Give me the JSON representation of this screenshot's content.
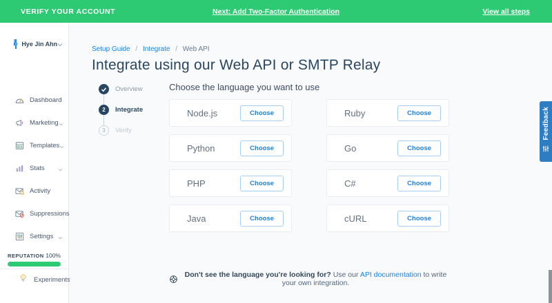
{
  "banner": {
    "title": "VERIFY YOUR ACCOUNT",
    "next_link": "Next: Add Two-Factor Authentication",
    "view_all_link": "View all steps",
    "bg_color": "#2eca73"
  },
  "sidebar": {
    "user": {
      "name": "Hye Jin Ahn"
    },
    "items": [
      {
        "label": "Dashboard"
      },
      {
        "label": "Marketing"
      },
      {
        "label": "Templates"
      },
      {
        "label": "Stats"
      },
      {
        "label": "Activity"
      },
      {
        "label": "Suppressions"
      },
      {
        "label": "Settings"
      }
    ],
    "reputation": {
      "label": "REPUTATION",
      "value": "100%",
      "progress_pct": 100,
      "bar_color": "#2eca73"
    },
    "experiments": {
      "label": "Experiments"
    }
  },
  "main": {
    "breadcrumb": {
      "items": [
        {
          "label": "Setup Guide"
        },
        {
          "label": "Integrate"
        },
        {
          "label": "Web API"
        }
      ],
      "separator": "/"
    },
    "title": "Integrate using our Web API or SMTP Relay",
    "stepper": [
      {
        "label": "Overview",
        "state": "done"
      },
      {
        "label": "Integrate",
        "state": "active",
        "number": "2"
      },
      {
        "label": "Verify",
        "state": "pending",
        "number": "3"
      }
    ],
    "chooser_title": "Choose the language you want to use",
    "languages": [
      "Node.js",
      "Ruby",
      "Python",
      "Go",
      "PHP",
      "C#",
      "Java",
      "cURL"
    ],
    "choose_button_label": "Choose",
    "footer": {
      "bold": "Don't see the language you're looking for?",
      "pre_link": " Use our ",
      "link": "API documentation",
      "post_link": " to write your own integration."
    }
  },
  "feedback_tab": {
    "label": "Feedback",
    "bg_color": "#2e7cc2"
  },
  "accent_colors": {
    "green": "#2eca73",
    "blue": "#1a82e2",
    "slate": "#294661"
  }
}
